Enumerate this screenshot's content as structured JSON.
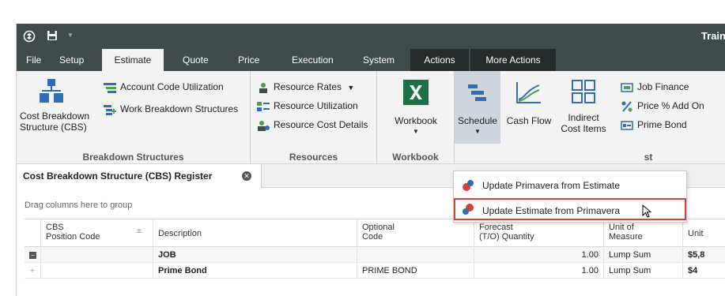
{
  "titlebar": {
    "title": "Train",
    "icons": [
      "app-logo-icon",
      "save-icon",
      "quick-access-dropdown-icon"
    ]
  },
  "tabs": [
    {
      "label": "File"
    },
    {
      "label": "Setup"
    },
    {
      "label": "Estimate"
    },
    {
      "label": "Quote"
    },
    {
      "label": "Price"
    },
    {
      "label": "Execution"
    },
    {
      "label": "System"
    },
    {
      "label": "Actions"
    },
    {
      "label": "More Actions"
    }
  ],
  "ribbon": {
    "breakdown": {
      "label": "Breakdown Structures",
      "cbs_line1": "Cost Breakdown",
      "cbs_line2": "Structure (CBS)",
      "account_code": "Account Code Utilization",
      "wbs": "Work Breakdown Structures"
    },
    "resources": {
      "label": "Resources",
      "rates": "Resource Rates",
      "utilization": "Resource Utilization",
      "cost_details": "Resource Cost Details"
    },
    "workbook": {
      "label": "Workbook",
      "button": "Workbook"
    },
    "schedule": {
      "schedule": "Schedule",
      "cash_flow": "Cash Flow",
      "indirect_line1": "Indirect",
      "indirect_line2": "Cost Items",
      "job_finance": "Job Finance",
      "price_add_on": "Price % Add On",
      "prime_bond": "Prime Bond",
      "label_partial": "st"
    }
  },
  "document": {
    "tab_title": "Cost Breakdown Structure (CBS) Register",
    "group_hint": "Drag columns here to group"
  },
  "grid": {
    "headers": {
      "cbs_line1": "CBS",
      "cbs_line2": "Position Code",
      "description": "Description",
      "optional_line1": "Optional",
      "optional_line2": "Code",
      "forecast_line1": "Forecast",
      "forecast_line2": "(T/O) Quantity",
      "uom_line1": "Unit of",
      "uom_line2": "Measure",
      "unit": "Unit"
    },
    "rows": [
      {
        "expander": "−",
        "description": "JOB",
        "optional_code": "",
        "quantity": "1.00",
        "uom": "Lump Sum",
        "unit": "$5,8"
      },
      {
        "expander": "+",
        "description": "Prime Bond",
        "optional_code": "PRIME BOND",
        "quantity": "1.00",
        "uom": "Lump Sum",
        "unit": "$4"
      }
    ]
  },
  "menu": {
    "update_primavera": "Update Primavera from Estimate",
    "update_estimate": "Update Estimate from Primavera"
  },
  "colors": {
    "titlebar": "#3f4a4a",
    "ribbon": "#f3f3f3",
    "highlight_border": "#d9403a",
    "excel_green": "#1e7145",
    "accent_blue": "#2f6db5"
  }
}
